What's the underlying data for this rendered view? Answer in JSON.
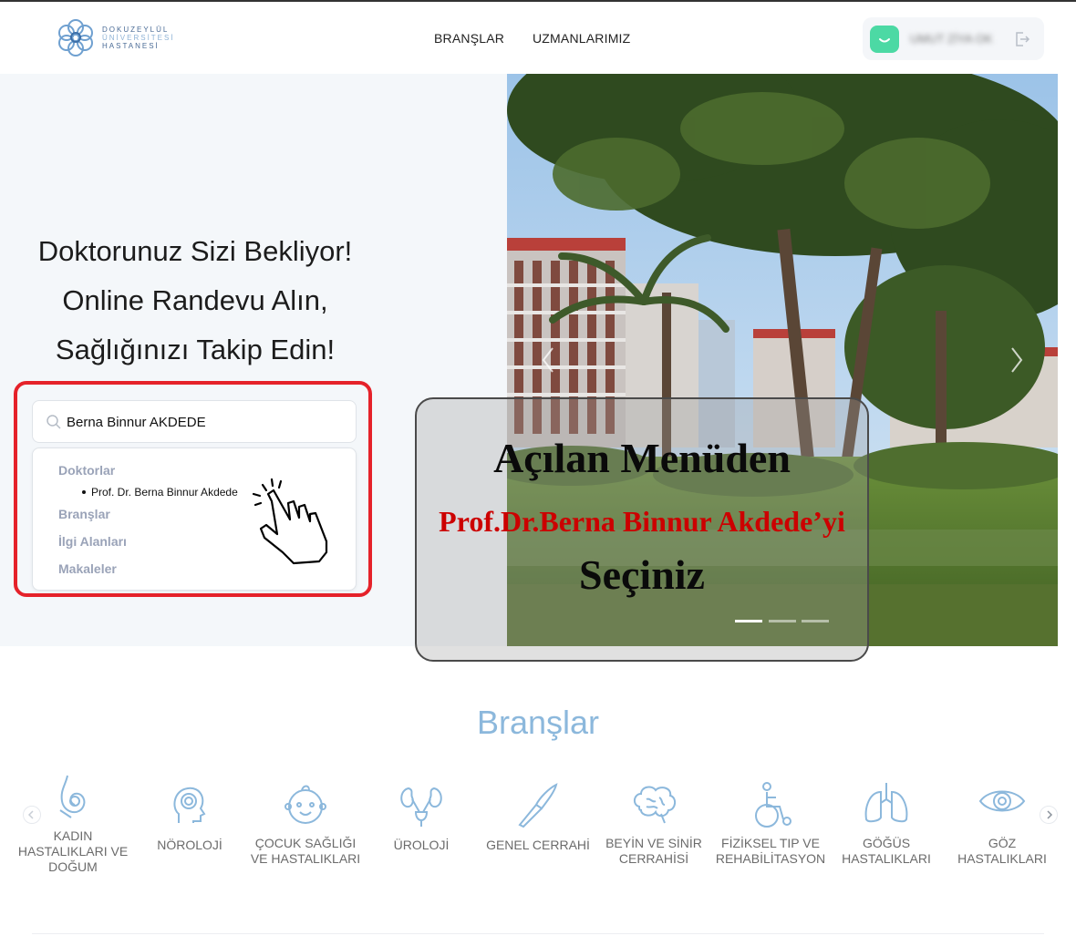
{
  "header": {
    "logo": {
      "line1": "DOKUZEYLÜL",
      "line2": "ÜNİVERSİTESİ",
      "line3": "HASTANESİ"
    },
    "nav": [
      {
        "label": "BRANŞLAR"
      },
      {
        "label": "UZMANLARIMIZ"
      }
    ],
    "user": {
      "name": "UMUT ZİYA OK",
      "avatar_color": "#4cd9a4"
    }
  },
  "hero": {
    "title_lines": [
      "Doktorunuz Sizi Bekliyor!",
      "Online Randevu Alın,",
      "Sağlığınızı Takip Edin!"
    ]
  },
  "search": {
    "value": "Berna Binnur AKDEDE",
    "categories": {
      "doctors": "Doktorlar",
      "branches": "Branşlar",
      "interests": "İlgi Alanları",
      "articles": "Makaleler"
    },
    "doctor_results": [
      "Prof. Dr. Berna Binnur Akdede"
    ]
  },
  "callout": {
    "line1": "Açılan Menüden",
    "line2": "Prof.Dr.Berna Binnur Akdede’yi",
    "line3": "Seçiniz",
    "highlight_color": "#cc0000"
  },
  "branches": {
    "title": "Branşlar",
    "items": [
      {
        "label": "KADIN HASTALIKLARI VE DOĞUM",
        "icon": "pregnancy-icon"
      },
      {
        "label": "NÖROLOJİ",
        "icon": "neurology-head-icon"
      },
      {
        "label": "ÇOCUK SAĞLIĞI VE HASTALIKLARI",
        "icon": "baby-face-icon"
      },
      {
        "label": "ÜROLOJİ",
        "icon": "kidney-icon"
      },
      {
        "label": "GENEL CERRAHİ",
        "icon": "scalpel-icon"
      },
      {
        "label": "BEYİN VE SİNİR CERRAHİSİ",
        "icon": "brain-icon"
      },
      {
        "label": "FİZİKSEL TIP VE REHABİLİTASYON",
        "icon": "wheelchair-icon"
      },
      {
        "label": "GÖĞÜS HASTALIKLARI",
        "icon": "lungs-icon"
      },
      {
        "label": "GÖZ HASTALIKLARI",
        "icon": "eye-icon"
      }
    ]
  }
}
